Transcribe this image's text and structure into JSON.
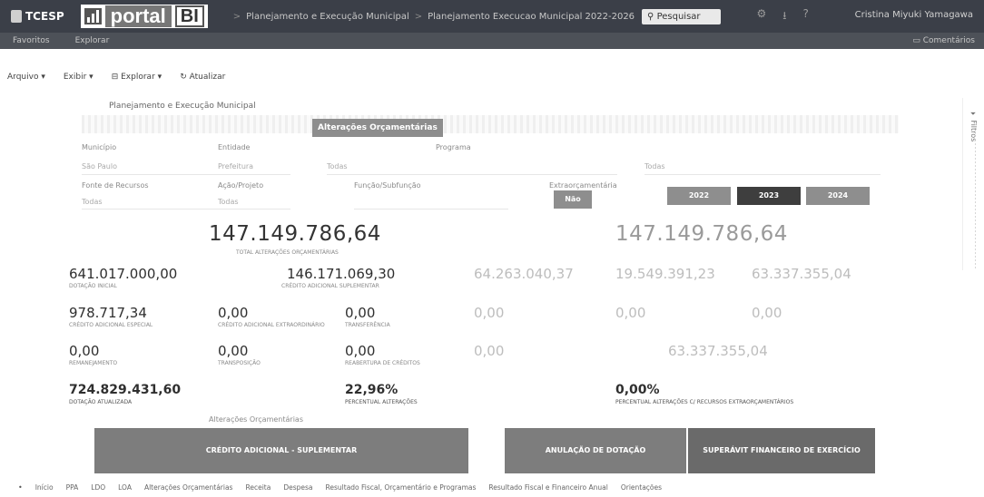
{
  "header": {
    "logo_tce": "TCESP",
    "logo_portal": "portal",
    "logo_bi": "BI",
    "breadcrumbs": [
      "Planejamento e Execução Municipal",
      "Planejamento Execucao Municipal 2022-2026"
    ],
    "search_label": "Pesquisar",
    "user_name": "Cristina Miyuki Yamagawa"
  },
  "subbar": {
    "items": [
      "Favoritos",
      "Explorar"
    ],
    "comments_label": "Comentários"
  },
  "menu": {
    "items": [
      "Arquivo",
      "Exibir",
      "Explorar",
      "Atualizar"
    ]
  },
  "report": {
    "title": "Planejamento e Execução Municipal",
    "section_badge": "Alterações Orçamentárias",
    "field_labels": [
      "Município",
      "Entidade",
      "Programa",
      "Fonte de Recursos",
      "Ação/Projeto",
      "Função/Subfunção",
      "Extraorçamentária"
    ],
    "field_values": [
      "São Paulo",
      "Prefeitura",
      "Todas",
      "Todas",
      "Todas",
      "Todas"
    ],
    "toggle_nao": "Não",
    "years": [
      "2022",
      "2023",
      "2024"
    ],
    "selected_year": "2023",
    "kpi_main_left": {
      "value": "147.149.786,64",
      "label": "Total alterações orçamentárias"
    },
    "kpi_main_right": {
      "value": "147.149.786,64"
    },
    "kpis": [
      {
        "value": "641.017.000,00",
        "label": "Dotação inicial"
      },
      {
        "value": "146.171.069,30",
        "label": "Crédito adicional suplementar"
      },
      {
        "value": "64.263.040,37"
      },
      {
        "value": "19.549.391,23"
      },
      {
        "value": "63.337.355,04"
      },
      {
        "value": "978.717,34",
        "label": "Crédito adicional especial"
      },
      {
        "value": "0,00",
        "label": "Crédito adicional extraordinário"
      },
      {
        "value": "0,00",
        "label": "Transferência"
      },
      {
        "value": "0,00"
      },
      {
        "value": "0,00"
      },
      {
        "value": "0,00"
      },
      {
        "value": "0,00",
        "label": "Remanejamento"
      },
      {
        "value": "0,00",
        "label": "Transposição"
      },
      {
        "value": "0,00",
        "label": "Reabertura de créditos"
      },
      {
        "value": "0,00"
      },
      {
        "value": "63.337.355,04"
      }
    ],
    "bottom_kpis": [
      {
        "value": "724.829.431,60",
        "label": "Dotação atualizada"
      },
      {
        "value": "22,96%",
        "label": "Percentual alterações"
      },
      {
        "value": "0,00%",
        "label": "Percentual alterações c/ recursos extraorçamentários"
      }
    ],
    "bar_group_label": "Alterações Orçamentárias",
    "bars": [
      {
        "label": "CRÉDITO ADICIONAL - SUPLEMENTAR"
      },
      {
        "label": "ANULAÇÃO DE DOTAÇÃO"
      },
      {
        "label": "SUPERÁVIT FINANCEIRO DE EXERCÍCIO ANTERIOR"
      }
    ]
  },
  "tabs": [
    "Início",
    "PPA",
    "LDO",
    "LOA",
    "Alterações Orçamentárias",
    "Receita",
    "Despesa",
    "Resultado Fiscal, Orçamentário e Programas",
    "Resultado Fiscal e Financeiro Anual",
    "Orientações"
  ],
  "filters_label": "Filtros"
}
